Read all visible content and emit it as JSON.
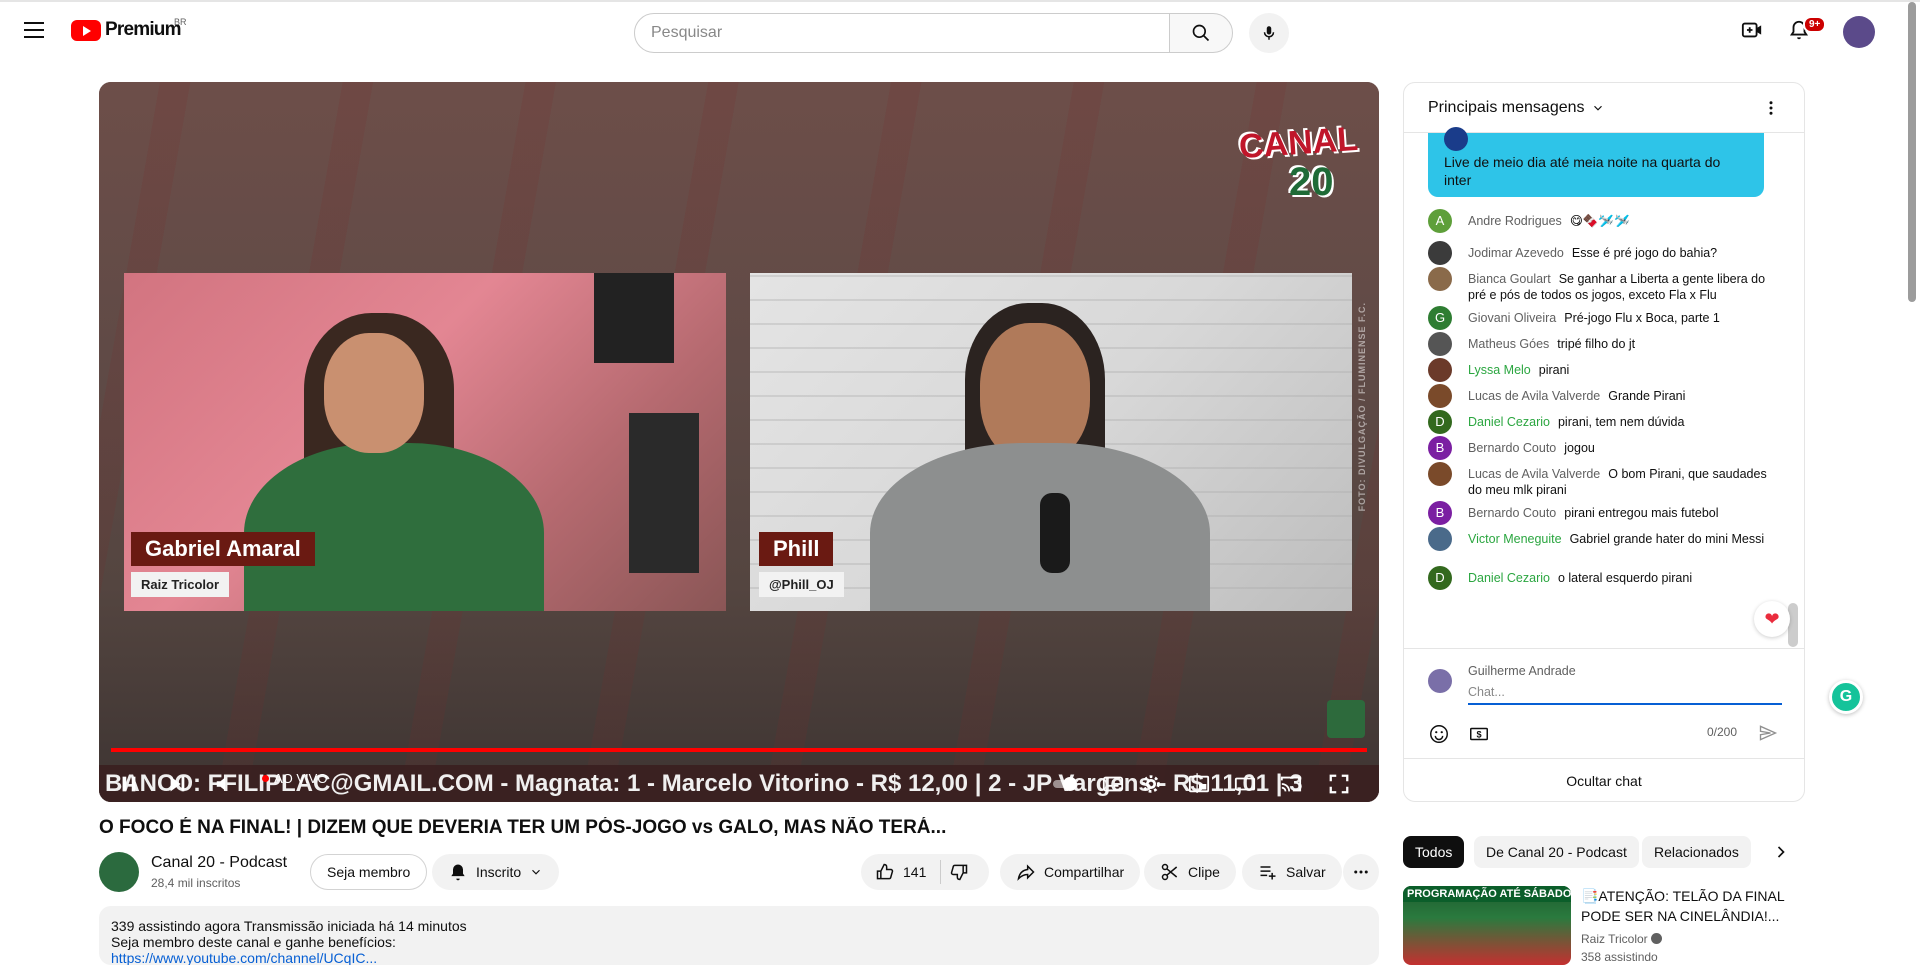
{
  "header": {
    "logo_text": "Premium",
    "region": "BR",
    "search_placeholder": "Pesquisar",
    "notifications_count": "9+"
  },
  "player": {
    "left_name": "Gabriel Amaral",
    "left_sub": "Raiz Tricolor",
    "right_name": "Phill",
    "right_sub": "@Phill_OJ",
    "logo_line1": "CANAL",
    "logo_line2": "20",
    "photo_credit": "FOTO: DIVULGAÇÃO / FLUMINENSE F.C.",
    "ticker": "BANCO: FFILIPLAC@GMAIL.COM - Magnata: 1 - Marcelo Vitorino - R$ 12,00 | 2 - JP Vargens - R$ 11,01 | 3",
    "live_label": "AO VIVO",
    "progress": 1.0
  },
  "video": {
    "title": "O FOCO É NA FINAL! | DIZEM QUE DEVERIA TER UM PÓS-JOGO vs GALO, MAS NÃO TERÁ...",
    "channel_name": "Canal 20 - Podcast",
    "subscribers": "28,4 mil inscritos",
    "join_label": "Seja membro",
    "subscribed_label": "Inscrito",
    "likes": "141",
    "share_label": "Compartilhar",
    "clip_label": "Clipe",
    "save_label": "Salvar",
    "desc_line1": "339 assistindo agora  Transmissão iniciada há 14 minutos",
    "desc_line2": "Seja membro deste canal e ganhe benefícios:",
    "desc_link": "https://www.youtube.com/channel/UCqIC..."
  },
  "chat": {
    "header_label": "Principais mensagens",
    "pinned_text": "Live de meio dia até meia noite na quarta do inter",
    "messages": [
      {
        "initial": "A",
        "color": "#5e9f3a",
        "name": "Andre Rodrigues",
        "text": "😋🍫🛩️🛩️",
        "member": false
      },
      {
        "initial": "",
        "color": "#3b3b3b",
        "name": "Jodimar Azevedo",
        "text": "Esse é pré jogo do bahia?",
        "member": false
      },
      {
        "initial": "",
        "color": "#8a6a4a",
        "name": "Bianca Goulart",
        "text": "Se ganhar a Liberta a gente libera do pré e pós de todos os jogos, exceto Fla x Flu",
        "member": false
      },
      {
        "initial": "G",
        "color": "#2e7d32",
        "name": "Giovani Oliveira",
        "text": "Pré-jogo Flu x Boca, parte 1",
        "member": false
      },
      {
        "initial": "",
        "color": "#555555",
        "name": "Matheus Góes",
        "text": "tripé filho do jt",
        "member": false
      },
      {
        "initial": "",
        "color": "#6b3a2a",
        "name": "Lyssa Melo",
        "text": "pirani",
        "member": true
      },
      {
        "initial": "",
        "color": "#7a4a2a",
        "name": "Lucas de Avila Valverde",
        "text": "Grande Pirani",
        "member": false
      },
      {
        "initial": "D",
        "color": "#33691e",
        "name": "Daniel Cezario",
        "text": "pirani, tem nem dúvida",
        "member": true
      },
      {
        "initial": "B",
        "color": "#7b1fa2",
        "name": "Bernardo Couto",
        "text": "jogou",
        "member": false
      },
      {
        "initial": "",
        "color": "#7a4a2a",
        "name": "Lucas de Avila Valverde",
        "text": "O bom Pirani, que saudades do meu mlk pirani",
        "member": false
      },
      {
        "initial": "B",
        "color": "#7b1fa2",
        "name": "Bernardo Couto",
        "text": "pirani entregou mais futebol",
        "member": false
      },
      {
        "initial": "",
        "color": "#4a6a8a",
        "name": "Victor Meneguite",
        "text": "Gabriel grande hater do mini Messi",
        "member": true
      },
      {
        "initial": "D",
        "color": "#33691e",
        "name": "Daniel Cezario",
        "text": "o lateral esquerdo pirani",
        "member": true
      }
    ],
    "composer_name": "Guilherme Andrade",
    "composer_placeholder": "Chat...",
    "counter": "0/200",
    "hide_label": "Ocultar chat"
  },
  "chips": [
    "Todos",
    "De Canal 20 - Podcast",
    "Relacionados"
  ],
  "related": {
    "thumb_text": "PROGRAMAÇÃO ATÉ SÁBADO",
    "title": "📑ATENÇÃO: TELÃO DA FINAL PODE SER NA CINELÂNDIA!...",
    "channel": "Raiz Tricolor",
    "viewers": "358 assistindo"
  }
}
